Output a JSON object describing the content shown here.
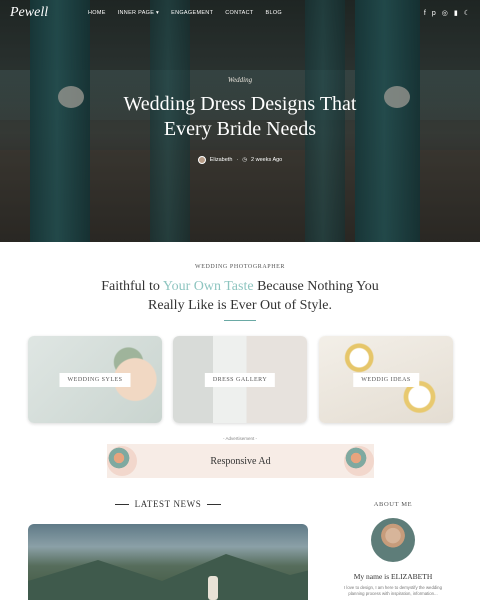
{
  "nav": {
    "logo": "Pewell",
    "items": [
      "HOME",
      "INNER PAGE ▾",
      "ENGAGEMENT",
      "CONTACT",
      "BLOG"
    ],
    "social_icons": [
      "facebook-icon",
      "pinterest-icon",
      "instagram-icon",
      "book-icon",
      "moon-icon"
    ]
  },
  "hero": {
    "category": "Wedding",
    "title_line1": "Wedding Dress Designs That",
    "title_line2": "Every Bride Needs",
    "author": "Elizabeth",
    "time": "2 weeks Ago"
  },
  "intro": {
    "subheading": "WEDDING PHOTOGRAPHER",
    "headline_part1": "Faithful to ",
    "headline_accent": "Your Own Taste",
    "headline_part2": " Because Nothing You",
    "headline_line2": "Really Like is Ever Out of Style."
  },
  "cards": [
    {
      "label": "WEDDING SYLES"
    },
    {
      "label": "DRESS GALLERY"
    },
    {
      "label": "WEDDIG IDEAS"
    }
  ],
  "ad": {
    "small_label": "- Advertisement -",
    "text": "Responsive Ad"
  },
  "news": {
    "title": "LATEST NEWS"
  },
  "about": {
    "title": "ABOUT ME",
    "name": "My name is ELIZABETH",
    "text": "I love to design, I am here to demystify the wedding planning process with inspiration, information..."
  },
  "colors": {
    "accent": "#8ec5c0",
    "rule": "#6aa9a4"
  }
}
